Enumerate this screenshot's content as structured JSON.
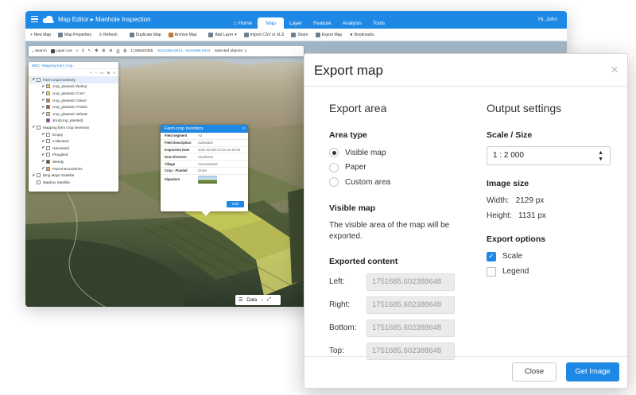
{
  "app": {
    "breadcrumb": [
      "Map Editor",
      "Manhole Inspection"
    ],
    "nav": [
      "Home",
      "Map",
      "Layer",
      "Feature",
      "Analysis",
      "Tools"
    ],
    "user": "Hi, John",
    "ribbon": [
      "New Map",
      "Map Properties",
      "Refresh",
      "Duplicate Map",
      "Archive Map",
      "Add Layer",
      "Import CSV or XLS",
      "Share",
      "Export Map",
      "Bookmarks"
    ],
    "map_toolbar": {
      "search": "Search",
      "layer_list": "Layer List",
      "scale": "1:295820355",
      "coords": "-6123456.0014, -6123456.0014",
      "selected": "Selected objects: 1"
    },
    "layers": {
      "title": "MDC: Mapping farm crop...",
      "items": [
        {
          "label": "Farm crop inventory",
          "checked": true,
          "color": "#ffffff"
        },
        {
          "label": "crop_planted='Barley'",
          "checked": true,
          "color": "#e8c84a"
        },
        {
          "label": "crop_planted='Corn'",
          "checked": true,
          "color": "#f2e04a"
        },
        {
          "label": "crop_planted='Onion'",
          "checked": true,
          "color": "#c48b3a"
        },
        {
          "label": "crop_planted='Potato'",
          "checked": true,
          "color": "#b15c2a"
        },
        {
          "label": "crop_planted='Wheat'",
          "checked": true,
          "color": "#d8d08a"
        },
        {
          "label": "strut(crop_planted)",
          "checked": false,
          "color": "#9c3aa6"
        },
        {
          "label": "Mapping farm crop inventory",
          "checked": true,
          "color": "#ffffff"
        },
        {
          "label": "Empty",
          "checked": true,
          "color": "#ffffff"
        },
        {
          "label": "Cultivated",
          "checked": true,
          "color": "#ffffff"
        },
        {
          "label": "Harvested",
          "checked": true,
          "color": "#ffffff"
        },
        {
          "label": "Ploughed",
          "checked": true,
          "color": "#ffffff"
        },
        {
          "label": "Weedy",
          "checked": true,
          "color": "#6b4a2a"
        },
        {
          "label": "Parcel Bounderies",
          "checked": true,
          "color": "#e9a04a"
        },
        {
          "label": "Bing Maps Satellite",
          "checked": true,
          "color": "#ffffff"
        },
        {
          "label": "Mapbox Satellite",
          "checked": false,
          "color": "#ffffff"
        }
      ]
    },
    "popup": {
      "title": "Farm crop inventory",
      "rows": [
        {
          "k": "Field segment",
          "v": "A3"
        },
        {
          "k": "Field description",
          "v": "Cultivated"
        },
        {
          "k": "Inspection Date",
          "v": "2021-02-06T13:15:13+02:00"
        },
        {
          "k": "Row direction",
          "v": "Southeast"
        },
        {
          "k": "Tillage",
          "v": "Conventional"
        },
        {
          "k": "Crop - Planted",
          "v": "Onion"
        }
      ],
      "signature": "Signature",
      "edit": "Edit"
    },
    "data_label": "Data"
  },
  "dialog": {
    "title": "Export map",
    "close_icon": "×",
    "export_area": {
      "title": "Export area",
      "area_type_label": "Area type",
      "options": [
        {
          "label": "Visible map",
          "selected": true
        },
        {
          "label": "Paper",
          "selected": false
        },
        {
          "label": "Custom area",
          "selected": false
        }
      ],
      "visible_map_label": "Visible map",
      "visible_map_desc": "The visible area of the map will be exported.",
      "exported_content_label": "Exported content",
      "coords": [
        {
          "k": "Left:",
          "v": "1751685.602388648"
        },
        {
          "k": "Right:",
          "v": "1751685.602388648"
        },
        {
          "k": "Bottom:",
          "v": "1751685.602388648"
        },
        {
          "k": "Top:",
          "v": "1751685.602388648"
        }
      ]
    },
    "output": {
      "title": "Output settings",
      "scale_label": "Scale / Size",
      "scale_value": "1 : 2 000",
      "image_size_label": "Image size",
      "width": "Width:   2129 px",
      "height": "Height:   1131 px",
      "options_label": "Export options",
      "options": [
        {
          "label": "Scale",
          "checked": true
        },
        {
          "label": "Legend",
          "checked": false
        }
      ]
    },
    "close_button": "Close",
    "get_button": "Get Image"
  },
  "colors": {
    "accent": "#1e88e5"
  }
}
